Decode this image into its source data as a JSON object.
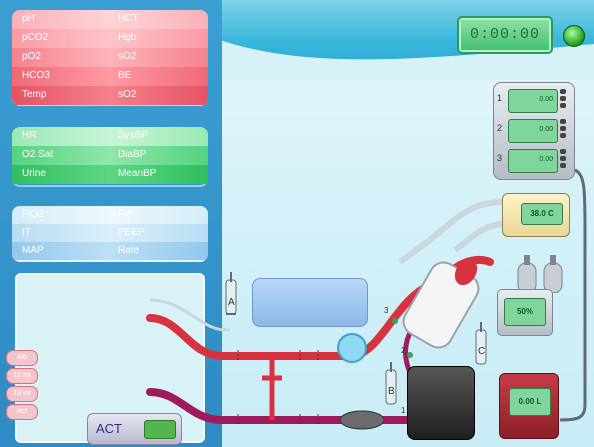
{
  "timer": {
    "value": "0:00:00"
  },
  "blood_gas_panel": {
    "rows": [
      {
        "left": "pH",
        "right": "HCT"
      },
      {
        "left": "pCO2",
        "right": "Hgb"
      },
      {
        "left": "pO2",
        "right": "sO2"
      },
      {
        "left": "HCO3",
        "right": "BE"
      },
      {
        "left": "Temp",
        "right": "sO2"
      }
    ]
  },
  "hemodynamics_panel": {
    "rows": [
      {
        "left": "HR",
        "right": "SysBP"
      },
      {
        "left": "O2 Sat",
        "right": "DiaBP"
      },
      {
        "left": "Urine",
        "right": "MeanBP"
      }
    ]
  },
  "ventilator_panel": {
    "rows": [
      {
        "left": "FiO2",
        "right": "PIP"
      },
      {
        "left": "IT",
        "right": "PEEP"
      },
      {
        "left": "MAP",
        "right": "Rate"
      }
    ]
  },
  "side_tabs": [
    {
      "label": "Alb"
    },
    {
      "label": "10 ml"
    },
    {
      "label": "10 ml"
    },
    {
      "label": "Hct"
    }
  ],
  "act": {
    "label": "ACT",
    "value": ""
  },
  "clamps": {
    "a": "A",
    "b": "B",
    "c": "C"
  },
  "port_numbers": {
    "p1": "1",
    "p2": "2",
    "p3": "3"
  },
  "pump_bank": {
    "slots": [
      {
        "number": "1",
        "value": "0.00"
      },
      {
        "number": "2",
        "value": "0.00"
      },
      {
        "number": "3",
        "value": "0.00"
      }
    ]
  },
  "heater": {
    "value": "38.0 C"
  },
  "gas_blender": {
    "value": "50%"
  },
  "flow_meter": {
    "value": "0.00 L"
  },
  "colors": {
    "arterial": "#d9323f",
    "venous": "#a01b5e",
    "banner": "#3bb7dc"
  }
}
